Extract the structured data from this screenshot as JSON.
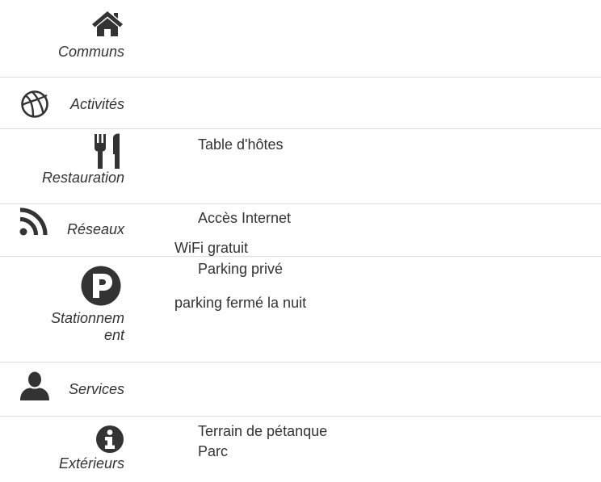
{
  "categories": {
    "communs": {
      "label": "Communs",
      "icon": "home-icon"
    },
    "activites": {
      "label": "Activités",
      "icon": "basketball-icon"
    },
    "restauration": {
      "label": "Restauration",
      "icon": "fork-knife-icon",
      "items": [
        "Table d'hôtes"
      ]
    },
    "reseaux": {
      "label": "Réseaux",
      "icon": "rss-icon",
      "items": [
        "Accès Internet"
      ],
      "details": [
        "WiFi gratuit"
      ]
    },
    "stationnement": {
      "label_line1": "Stationnem",
      "label_line2": "ent",
      "icon": "parking-icon",
      "items": [
        "Parking privé"
      ],
      "details": [
        "parking fermé la nuit"
      ]
    },
    "services": {
      "label": "Services",
      "icon": "user-icon"
    },
    "exterieurs": {
      "label": "Extérieurs",
      "icon": "info-icon",
      "items": [
        "Terrain de pétanque",
        "Parc"
      ]
    }
  },
  "colors": {
    "icon": "#333333",
    "text": "#333333",
    "divider": "#dcdcdc"
  }
}
